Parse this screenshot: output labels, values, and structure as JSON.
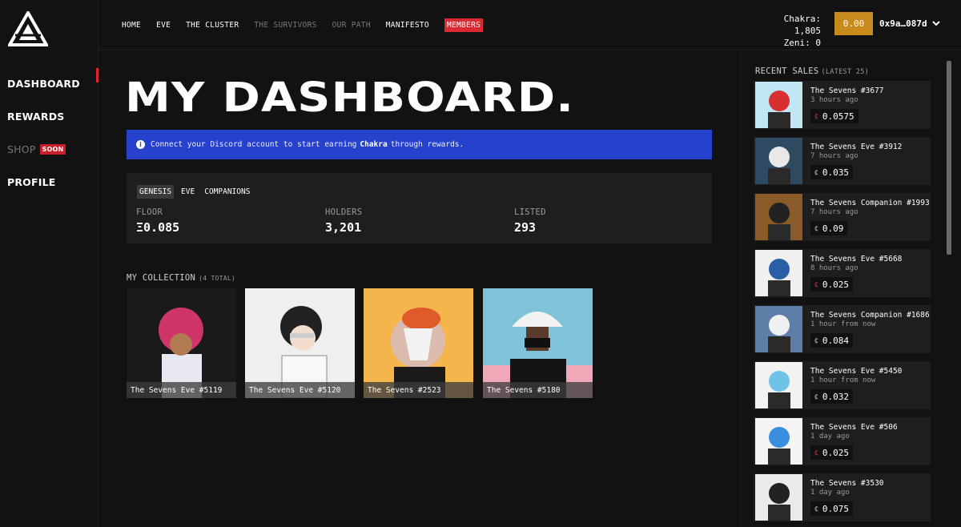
{
  "sidebar": {
    "items": [
      {
        "label": "DASHBOARD",
        "state": "active"
      },
      {
        "label": "REWARDS",
        "state": "normal"
      },
      {
        "label": "SHOP",
        "state": "muted",
        "badge": "SOON"
      },
      {
        "label": "PROFILE",
        "state": "normal"
      }
    ]
  },
  "topnav": {
    "links": [
      {
        "label": "HOME",
        "dim": false
      },
      {
        "label": "EVE",
        "dim": false
      },
      {
        "label": "THE CLUSTER",
        "dim": false
      },
      {
        "label": "THE SURVIVORS",
        "dim": true
      },
      {
        "label": "OUR PATH",
        "dim": true
      },
      {
        "label": "MANIFESTO",
        "dim": false
      },
      {
        "label": "MEMBERS",
        "dim": false,
        "highlight": "#d92a32"
      }
    ]
  },
  "account": {
    "chakra": "Chakra: 1,805",
    "zeni": "Zeni: 0",
    "deposit": "0.00",
    "wallet": "0x9a…087d"
  },
  "main": {
    "title": "MY DASHBOARD.",
    "alert": {
      "pre": "Connect your Discord account to start earning",
      "bold": "Chakra",
      "post": "through rewards."
    },
    "tabs": [
      {
        "label": "GENESIS",
        "active": true
      },
      {
        "label": "EVE",
        "active": false
      },
      {
        "label": "COMPANIONS",
        "active": false
      }
    ],
    "stats": [
      {
        "label": "FLOOR",
        "value": "Ξ0.085"
      },
      {
        "label": "HOLDERS",
        "value": "3,201"
      },
      {
        "label": "LISTED",
        "value": "293"
      }
    ],
    "collection_title": "MY COLLECTION",
    "collection_count": "(4 TOTAL)",
    "collection": [
      {
        "name": "The Sevens Eve #5119",
        "bg": "#1a1a1a",
        "accent": "#d0356a"
      },
      {
        "name": "The Sevens Eve #5120",
        "bg": "#efefef",
        "accent": "#222222"
      },
      {
        "name": "The Sevens #2523",
        "bg": "#f4b54c",
        "accent": "#e05a2a"
      },
      {
        "name": "The Sevens #5180",
        "bg": "#7ec3d8",
        "accent": "#f2f2f2"
      }
    ]
  },
  "sales": {
    "title": "RECENT SALES",
    "subtitle": "(LATEST 25)",
    "items": [
      {
        "name": "The Sevens #3677",
        "time": "3 hours ago",
        "price": "0.0575",
        "sym": "red",
        "bg": "#bfe6f2",
        "accent": "#d83030"
      },
      {
        "name": "The Sevens Eve #3912",
        "time": "7 hours ago",
        "price": "0.035",
        "sym": "white",
        "bg": "#2e4a62",
        "accent": "#e8e8e8"
      },
      {
        "name": "The Sevens Companion #1993",
        "time": "7 hours ago",
        "price": "0.09",
        "sym": "white",
        "bg": "#8a5a28",
        "accent": "#222222"
      },
      {
        "name": "The Sevens Eve #5668",
        "time": "8 hours ago",
        "price": "0.025",
        "sym": "red",
        "bg": "#f0f0f0",
        "accent": "#2a5fa8"
      },
      {
        "name": "The Sevens Companion #1686",
        "time": "1 hour from now",
        "price": "0.084",
        "sym": "white",
        "bg": "#5d7ea8",
        "accent": "#f0f0f0"
      },
      {
        "name": "The Sevens Eve #5450",
        "time": "1 hour from now",
        "price": "0.032",
        "sym": "white",
        "bg": "#f2f2f2",
        "accent": "#6fc3e8"
      },
      {
        "name": "The Sevens Eve #506",
        "time": "1 day ago",
        "price": "0.025",
        "sym": "red",
        "bg": "#f4f4f4",
        "accent": "#3a8ee0"
      },
      {
        "name": "The Sevens #3530",
        "time": "1 day ago",
        "price": "0.075",
        "sym": "white",
        "bg": "#eaeaea",
        "accent": "#222222"
      }
    ]
  }
}
